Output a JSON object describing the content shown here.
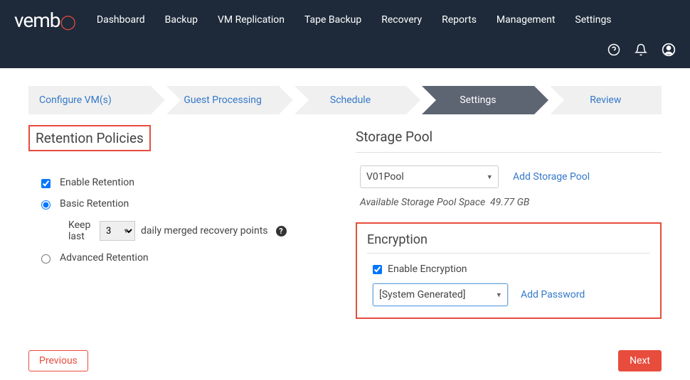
{
  "logo": "vembu",
  "nav": [
    "Dashboard",
    "Backup",
    "VM Replication",
    "Tape Backup",
    "Recovery",
    "Reports",
    "Management",
    "Settings"
  ],
  "wizard": {
    "steps": [
      "Configure VM(s)",
      "Guest Processing",
      "Schedule",
      "Settings",
      "Review"
    ],
    "active_index": 3
  },
  "retention": {
    "title": "Retention Policies",
    "enable_label": "Enable Retention",
    "enable_checked": true,
    "basic_label": "Basic Retention",
    "basic_selected": true,
    "keep_label": "Keep last",
    "keep_value": "3",
    "keep_suffix": "daily merged recovery points",
    "advanced_label": "Advanced Retention",
    "advanced_selected": false
  },
  "storage": {
    "title": "Storage Pool",
    "pool_value": "V01Pool",
    "add_pool_label": "Add Storage Pool",
    "avail_label": "Available Storage Pool Space",
    "avail_value": "49.77 GB"
  },
  "encryption": {
    "title": "Encryption",
    "enable_label": "Enable Encryption",
    "enable_checked": true,
    "select_value": "[System Generated]",
    "add_password_label": "Add Password"
  },
  "footer": {
    "prev": "Previous",
    "next": "Next"
  }
}
